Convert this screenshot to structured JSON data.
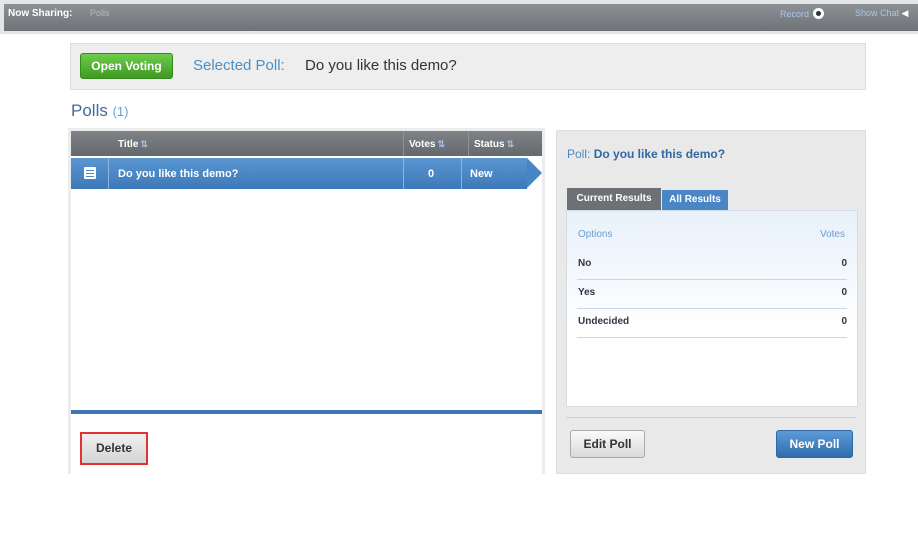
{
  "topbar": {
    "now_sharing_label": "Now Sharing:",
    "now_sharing_value": "Polls",
    "record_label": "Record",
    "show_chat_label": "Show Chat"
  },
  "selection": {
    "open_voting_label": "Open Voting",
    "selected_poll_label": "Selected Poll:",
    "selected_poll_value": "Do you like this demo?"
  },
  "polls": {
    "heading": "Polls",
    "count": "(1)",
    "columns": {
      "title": "Title",
      "votes": "Votes",
      "status": "Status"
    },
    "rows": [
      {
        "title": "Do you like this demo?",
        "votes": "0",
        "status": "New"
      }
    ],
    "delete_label": "Delete"
  },
  "detail": {
    "poll_label": "Poll:",
    "poll_name": "Do you like this demo?",
    "tabs": [
      "Current Results",
      "All Results"
    ],
    "header": {
      "options": "Options",
      "votes": "Votes"
    },
    "options": [
      {
        "label": "No",
        "votes": "0"
      },
      {
        "label": "Yes",
        "votes": "0"
      },
      {
        "label": "Undecided",
        "votes": "0"
      }
    ],
    "edit_label": "Edit Poll",
    "new_label": "New Poll"
  },
  "colors": {
    "accent_blue": "#3d79b8",
    "open_voting_green": "#3e9a23",
    "delete_highlight": "#e03333"
  }
}
